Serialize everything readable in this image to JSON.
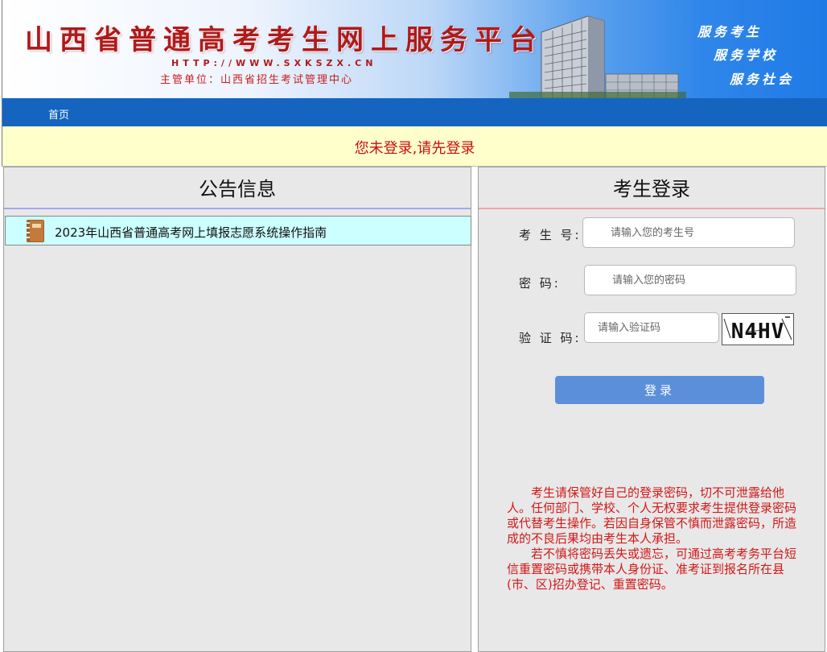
{
  "header": {
    "title": "山西省普通高考考生网上服务平台",
    "url": "HTTP://WWW.SXKSZX.CN",
    "owner": "主管单位：山西省招生考试管理中心",
    "slogans": [
      "服务考生",
      "服务学校",
      "服务社会"
    ]
  },
  "nav": {
    "items": [
      {
        "label": "首页"
      }
    ]
  },
  "notice": {
    "message": "您未登录,请先登录"
  },
  "announcements": {
    "title": "公告信息",
    "items": [
      {
        "label": "2023年山西省普通高考网上填报志愿系统操作指南",
        "icon": "book-icon"
      }
    ]
  },
  "login": {
    "title": "考生登录",
    "exam_no": {
      "label": "考 生 号:",
      "placeholder": "请输入您的考生号"
    },
    "password": {
      "label": "密  码:",
      "placeholder": "请输入您的密码"
    },
    "captcha": {
      "label": "验 证 码:",
      "placeholder": "请输入验证码",
      "image_text": "N4HV"
    },
    "submit_label": "登录",
    "warning_paragraphs": [
      "考生请保管好自己的登录密码，切不可泄露给他人。任何部门、学校、个人无权要求考生提供登录密码或代替考生操作。若因自身保管不慎而泄露密码，所造成的不良后果均由考生本人承担。",
      "若不慎将密码丢失或遗忘，可通过高考考务平台短信重置密码或携带本人身份证、准考证到报名所在县(市、区)招办登记、重置密码。"
    ]
  },
  "colors": {
    "title_red": "#b01a1a",
    "nav_blue": "#1565c0",
    "notice_bg": "#ffffcc",
    "warning_red": "#d21818",
    "button_blue": "#5b8fd9"
  }
}
